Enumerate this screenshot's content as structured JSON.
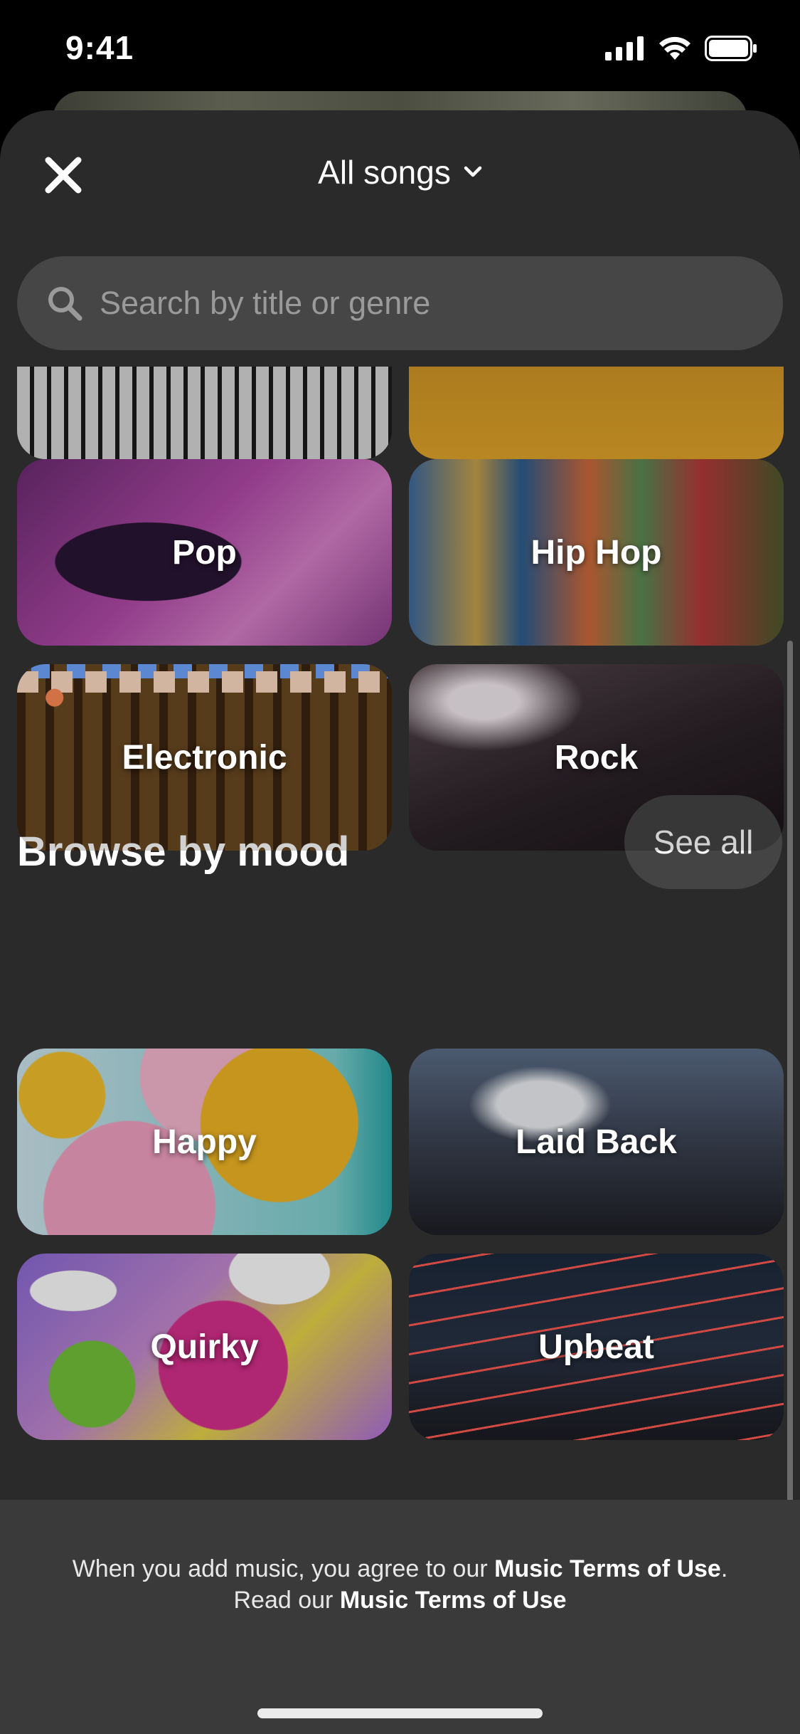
{
  "status_bar": {
    "time": "9:41"
  },
  "header": {
    "title": "All songs"
  },
  "search": {
    "placeholder": "Search by title or genre"
  },
  "genres": [
    {
      "label": "Pop"
    },
    {
      "label": "Hip Hop"
    },
    {
      "label": "Electronic"
    },
    {
      "label": "Rock"
    }
  ],
  "mood_section": {
    "title": "Browse by mood",
    "see_all": "See all",
    "items": [
      {
        "label": "Happy"
      },
      {
        "label": "Laid Back"
      },
      {
        "label": "Quirky"
      },
      {
        "label": "Upbeat"
      }
    ]
  },
  "footer": {
    "line1_prefix": "When you add music, you agree to our ",
    "line1_link": "Music Terms of Use",
    "line1_suffix": ".",
    "line2_prefix": "Read our ",
    "line2_link": "Music Terms of Use"
  }
}
